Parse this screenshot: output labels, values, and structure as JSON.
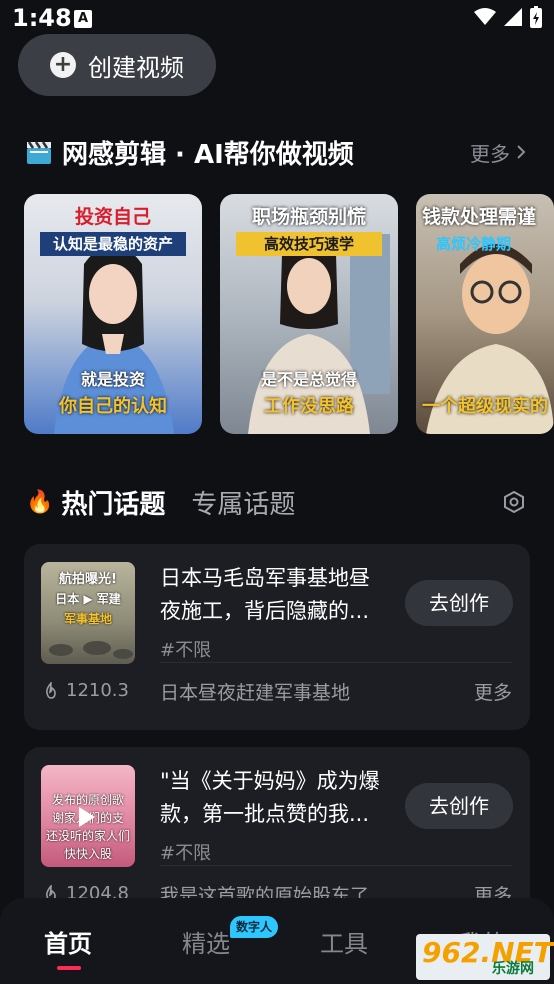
{
  "status": {
    "time": "1:48",
    "app_letter": "A"
  },
  "create_button": {
    "label": "创建视频"
  },
  "featured": {
    "title": "网感剪辑 · AI帮你做视频",
    "more": "更多",
    "cards": [
      {
        "top": "投资自己",
        "sub": "认知是最稳的资产",
        "line1": "就是投资",
        "line2": "你自己的认知"
      },
      {
        "top": "职场瓶颈别慌",
        "sub": "高效技巧速学",
        "line1": "是不是总觉得",
        "line2": "工作没思路"
      },
      {
        "top": "钱款处理需谨",
        "sub": "高烦冷静期",
        "line1": "",
        "line2": "一个超级现实的"
      }
    ]
  },
  "topics": {
    "tab_hot": "热门话题",
    "tab_exclusive": "专属话题",
    "items": [
      {
        "thumb_line1": "航拍曝光!",
        "thumb_line2": "日本 ▶ 军建",
        "thumb_line3": "军事基地",
        "title": "日本马毛岛军事基地昼夜施工，背后隐藏的...",
        "tag": "#不限",
        "action": "去创作",
        "heat": "1210.3",
        "keyword": "日本昼夜赶建军事基地",
        "more": "更多"
      },
      {
        "thumb_line1": "发布的原创歌",
        "thumb_line2": "谢家人们的支",
        "thumb_line3": "还没听的家人们",
        "thumb_line4": "快快入股",
        "title": "\"当《关于妈妈》成为爆款，第一批点赞的我...",
        "tag": "#不限",
        "action": "去创作",
        "heat": "1204.8",
        "keyword": "我是这首歌的原始股东了",
        "more": "更多"
      }
    ]
  },
  "nav": {
    "home": "首页",
    "featured": "精选",
    "badge": "数字人",
    "tools": "工具",
    "mine": "我的"
  },
  "watermark": {
    "big": "962.NET",
    "small": "乐游网"
  },
  "colors": {
    "accent": "#ff2d55",
    "badge": "#2ec6ff",
    "background": "#0f1014"
  }
}
